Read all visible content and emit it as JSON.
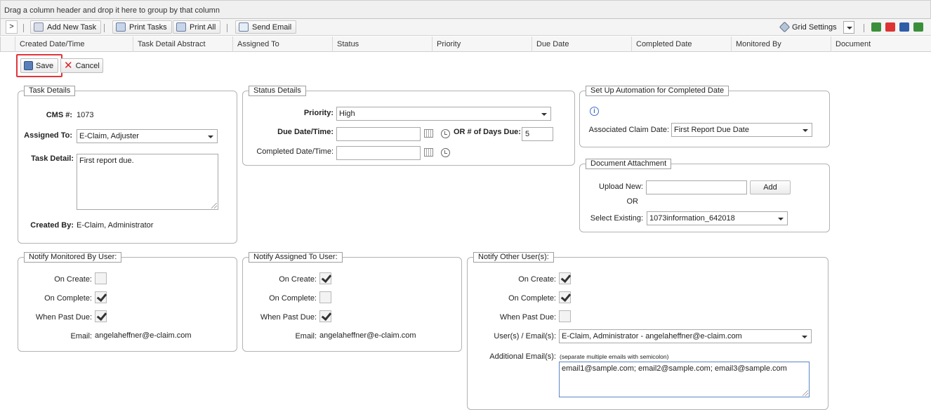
{
  "groupbar": {
    "text": "Drag a column header and drop it here to group by that column"
  },
  "toolbar": {
    "expand_label": ">",
    "add_new_task": "Add New Task",
    "print_tasks": "Print Tasks",
    "print_all": "Print All",
    "send_email": "Send Email",
    "grid_settings": "Grid Settings"
  },
  "columns": [
    "Created Date/Time",
    "Task Detail Abstract",
    "Assigned To",
    "Status",
    "Priority",
    "Due Date",
    "Completed Date",
    "Monitored By",
    "Document"
  ],
  "actions": {
    "save": "Save",
    "cancel": "Cancel"
  },
  "task_details": {
    "legend": "Task Details",
    "cms_label": "CMS #:",
    "cms_value": "1073",
    "assigned_label": "Assigned To:",
    "assigned_value": "E-Claim, Adjuster",
    "detail_label": "Task Detail:",
    "detail_value": "First report due.",
    "created_label": "Created By:",
    "created_value": "E-Claim, Administrator"
  },
  "status_details": {
    "legend": "Status Details",
    "priority_label": "Priority:",
    "priority_value": "High",
    "due_label": "Due Date/Time:",
    "due_value": "",
    "days_label": "OR # of Days Due:",
    "days_value": "5",
    "completed_label": "Completed Date/Time:",
    "completed_value": ""
  },
  "automation": {
    "legend": "Set Up Automation for Completed Date",
    "claim_date_label": "Associated Claim Date:",
    "claim_date_value": "First Report Due Date"
  },
  "attachment": {
    "legend": "Document Attachment",
    "upload_label": "Upload New:",
    "add_label": "Add",
    "or_label": "OR",
    "existing_label": "Select Existing:",
    "existing_value": "1073information_642018"
  },
  "notify_monitored": {
    "legend": "Notify Monitored By User:",
    "on_create": "On Create:",
    "on_complete": "On Complete:",
    "past_due": "When Past Due:",
    "on_create_checked": false,
    "on_complete_checked": true,
    "past_due_checked": true,
    "email_label": "Email:",
    "email_value": "angelaheffner@e-claim.com"
  },
  "notify_assigned": {
    "legend": "Notify Assigned To User:",
    "on_create": "On Create:",
    "on_complete": "On Complete:",
    "past_due": "When Past Due:",
    "on_create_checked": true,
    "on_complete_checked": false,
    "past_due_checked": true,
    "email_label": "Email:",
    "email_value": "angelaheffner@e-claim.com"
  },
  "notify_other": {
    "legend": "Notify Other User(s):",
    "on_create": "On Create:",
    "on_complete": "On Complete:",
    "past_due": "When Past Due:",
    "on_create_checked": true,
    "on_complete_checked": true,
    "past_due_checked": false,
    "users_label": "User(s) / Email(s):",
    "users_value": "E-Claim, Administrator - angelaheffner@e-claim.com",
    "additional_label": "Additional Email(s):",
    "additional_hint": "(separate multiple emails with semicolon)",
    "additional_value": "email1@sample.com; email2@sample.com; email3@sample.com"
  },
  "colors": {
    "highlight": "#e0353a",
    "info": "#3f6fc6"
  }
}
